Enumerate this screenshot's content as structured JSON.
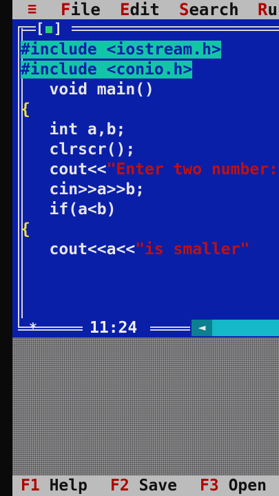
{
  "menubar": {
    "system_menu": "≡",
    "items": [
      {
        "hot": "F",
        "rest": "ile"
      },
      {
        "hot": "E",
        "rest": "dit"
      },
      {
        "hot": "S",
        "rest": "earch"
      },
      {
        "hot": "R",
        "rest": "u"
      }
    ]
  },
  "editor": {
    "window_number": "1",
    "lines": [
      {
        "text": "#include <iostream.h>",
        "style": "highlight"
      },
      {
        "text": "#include <conio.h>",
        "style": "highlight"
      },
      {
        "text": "   void main()",
        "style": "normal"
      },
      {
        "text": "{",
        "style": "brace"
      },
      {
        "text": "   int a,b;",
        "style": "normal"
      },
      {
        "text": "   clrscr();",
        "style": "normal"
      },
      {
        "pre": "   cout<<",
        "str": "\"Enter two number:",
        "style": "string"
      },
      {
        "text": "   cin>>a>>b;",
        "style": "normal"
      },
      {
        "text": "   if(a<b)",
        "style": "normal"
      },
      {
        "text": "{",
        "style": "brace"
      },
      {
        "pre": "   cout<<a<<",
        "str": "\"is smaller\"",
        "style": "string"
      }
    ]
  },
  "status": {
    "cursor_position": "11:24",
    "modified_icon": "asterisk-icon"
  },
  "keybar": {
    "keys": [
      {
        "key": "F1",
        "label": "Help"
      },
      {
        "key": "F2",
        "label": "Save"
      },
      {
        "key": "F3",
        "label": "Open"
      }
    ]
  },
  "colors": {
    "editor_bg": "#0a1fa8",
    "highlight": "#14c4a8",
    "string": "#c01010",
    "menubar_bg": "#bcbcbc"
  }
}
